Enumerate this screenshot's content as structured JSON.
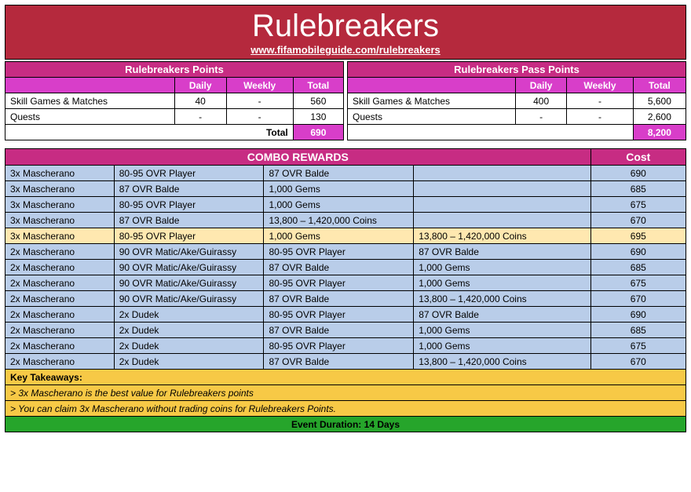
{
  "banner": {
    "title": "Rulebreakers",
    "link_text": "www.fifamobileguide.com/rulebreakers"
  },
  "points_left": {
    "title": "Rulebreakers Points",
    "cols": [
      "",
      "Daily",
      "Weekly",
      "Total"
    ],
    "rows": [
      {
        "label": "Skill Games & Matches",
        "daily": "40",
        "weekly": "-",
        "total": "560"
      },
      {
        "label": "Quests",
        "daily": "-",
        "weekly": "-",
        "total": "130"
      }
    ],
    "total_label": "Total",
    "total_value": "690"
  },
  "points_right": {
    "title": "Rulebreakers Pass Points",
    "cols": [
      "",
      "Daily",
      "Weekly",
      "Total"
    ],
    "rows": [
      {
        "label": "Skill Games & Matches",
        "daily": "400",
        "weekly": "-",
        "total": "5,600"
      },
      {
        "label": "Quests",
        "daily": "-",
        "weekly": "-",
        "total": "2,600"
      }
    ],
    "total_label": "",
    "total_value": "8,200"
  },
  "combo": {
    "title": "COMBO REWARDS",
    "cost_title": "Cost",
    "rows": [
      {
        "style": "row-blue",
        "c1": "3x Mascherano",
        "c2": "80-95 OVR Player",
        "c3": "87 OVR Balde",
        "c4": "",
        "cost": "690"
      },
      {
        "style": "row-blue",
        "c1": "3x Mascherano",
        "c2": "87 OVR Balde",
        "c3": "1,000 Gems",
        "c4": "",
        "cost": "685"
      },
      {
        "style": "row-blue",
        "c1": "3x Mascherano",
        "c2": "80-95 OVR Player",
        "c3": "1,000 Gems",
        "c4": "",
        "cost": "675"
      },
      {
        "style": "row-blue",
        "c1": "3x Mascherano",
        "c2": "87 OVR Balde",
        "c3": "13,800 – 1,420,000 Coins",
        "c4": "",
        "cost": "670"
      },
      {
        "style": "row-cream",
        "c1": "3x Mascherano",
        "c2": "80-95 OVR Player",
        "c3": "1,000 Gems",
        "c4": "13,800 – 1,420,000 Coins",
        "cost": "695"
      },
      {
        "style": "row-blue",
        "c1": "2x Mascherano",
        "c2": "90 OVR Matic/Ake/Guirassy",
        "c3": "80-95 OVR Player",
        "c4": "87 OVR Balde",
        "cost": "690"
      },
      {
        "style": "row-blue",
        "c1": "2x Mascherano",
        "c2": "90 OVR Matic/Ake/Guirassy",
        "c3": "87 OVR Balde",
        "c4": "1,000 Gems",
        "cost": "685"
      },
      {
        "style": "row-blue",
        "c1": "2x Mascherano",
        "c2": "90 OVR Matic/Ake/Guirassy",
        "c3": "80-95 OVR Player",
        "c4": "1,000 Gems",
        "cost": "675"
      },
      {
        "style": "row-blue",
        "c1": "2x Mascherano",
        "c2": "90 OVR Matic/Ake/Guirassy",
        "c3": "87 OVR Balde",
        "c4": "13,800 – 1,420,000 Coins",
        "cost": "670"
      },
      {
        "style": "row-blue",
        "c1": "2x Mascherano",
        "c2": "2x Dudek",
        "c3": "80-95 OVR Player",
        "c4": "87 OVR Balde",
        "cost": "690"
      },
      {
        "style": "row-blue",
        "c1": "2x Mascherano",
        "c2": "2x Dudek",
        "c3": "87 OVR Balde",
        "c4": "1,000 Gems",
        "cost": "685"
      },
      {
        "style": "row-blue",
        "c1": "2x Mascherano",
        "c2": "2x Dudek",
        "c3": "80-95 OVR Player",
        "c4": "1,000 Gems",
        "cost": "675"
      },
      {
        "style": "row-blue",
        "c1": "2x Mascherano",
        "c2": "2x Dudek",
        "c3": "87 OVR Balde",
        "c4": "13,800 – 1,420,000 Coins",
        "cost": "670"
      }
    ]
  },
  "takeaways": {
    "heading": "Key Takeaways:",
    "lines": [
      "> 3x Mascherano is the best value for Rulebreakers points",
      "> You can claim 3x Mascherano without trading coins for Rulebreakers Points."
    ]
  },
  "duration": "Event Duration: 14 Days"
}
